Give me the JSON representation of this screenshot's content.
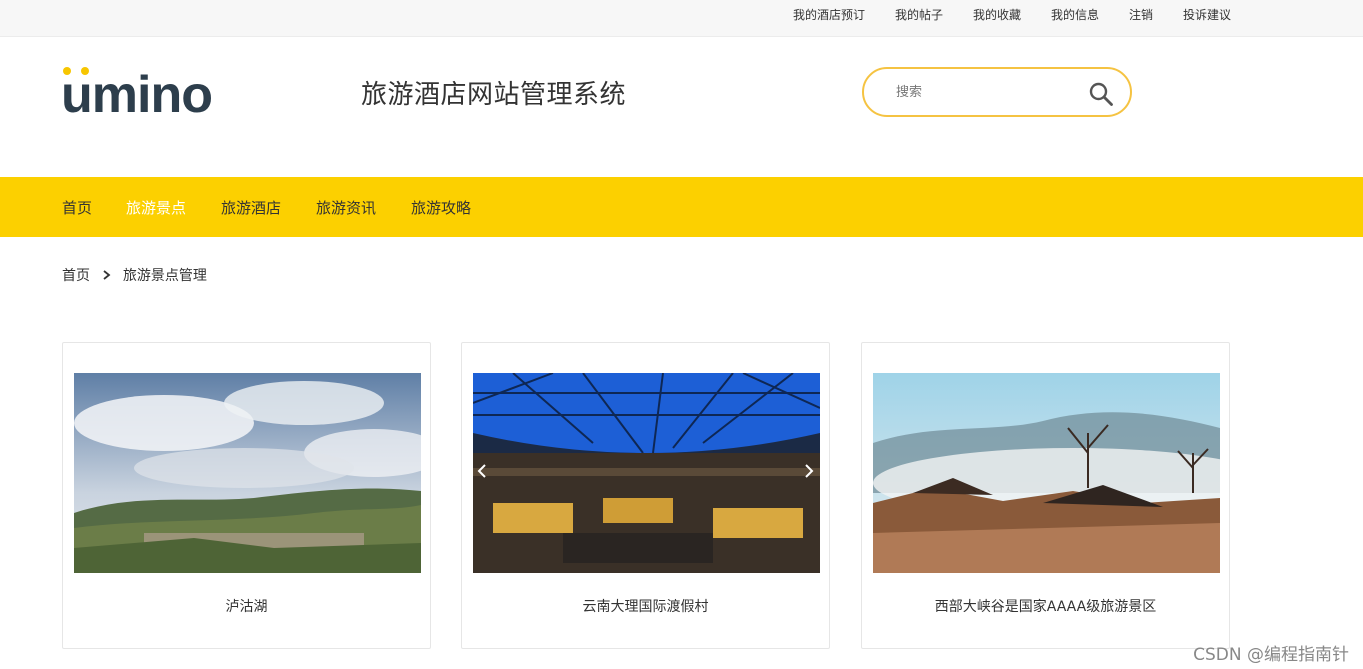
{
  "topbar": {
    "links": [
      "我的酒店预订",
      "我的帖子",
      "我的收藏",
      "我的信息",
      "注销",
      "投诉建议"
    ]
  },
  "header": {
    "logo_text": "ümino",
    "site_title": "旅游酒店网站管理系统",
    "search_placeholder": "搜索"
  },
  "nav": {
    "items": [
      "首页",
      "旅游景点",
      "旅游酒店",
      "旅游资讯",
      "旅游攻略"
    ],
    "active_index": 1
  },
  "breadcrumb": {
    "home": "首页",
    "current": "旅游景点管理"
  },
  "cards": [
    {
      "title": "泸沽湖",
      "image": "hillside-town-photo"
    },
    {
      "title": "云南大理国际渡假村",
      "image": "resort-dome-restaurant-photo"
    },
    {
      "title": "西部大峡谷是国家AAAA级旅游景区",
      "image": "misty-valley-village-photo"
    }
  ],
  "colors": {
    "accent_yellow": "#fcd000",
    "search_border": "#f5c342",
    "logo_dark": "#2d3e4c",
    "logo_dots": "#f7c600"
  },
  "watermark": "CSDN @编程指南针"
}
